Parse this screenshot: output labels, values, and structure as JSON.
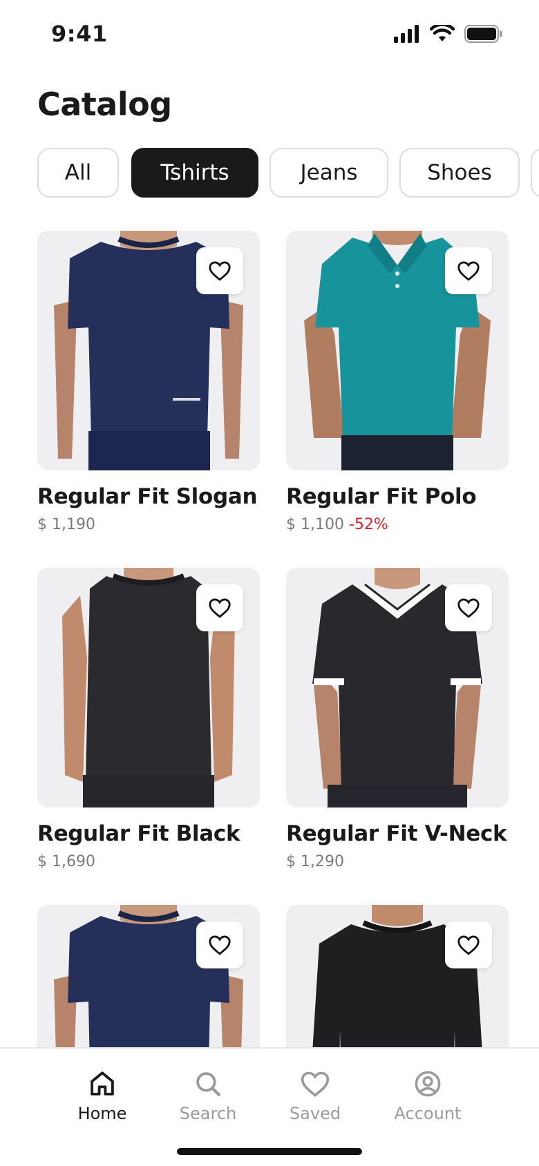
{
  "status": {
    "time": "9:41"
  },
  "header": {
    "title": "Catalog"
  },
  "filters": [
    {
      "label": "All",
      "active": false
    },
    {
      "label": "Tshirts",
      "active": true
    },
    {
      "label": "Jeans",
      "active": false
    },
    {
      "label": "Shoes",
      "active": false
    }
  ],
  "products": [
    {
      "name": "Regular Fit Slogan",
      "price": "$ 1,190",
      "discount": "",
      "color": "#24305a"
    },
    {
      "name": "Regular Fit Polo",
      "price": "$ 1,100",
      "discount": "-52%",
      "color": "#16939b"
    },
    {
      "name": "Regular Fit Black",
      "price": "$ 1,690",
      "discount": "",
      "color": "#2b2b2f"
    },
    {
      "name": "Regular Fit V-Neck",
      "price": "$ 1,290",
      "discount": "",
      "color": "#29282c"
    },
    {
      "name": "",
      "price": "",
      "discount": "",
      "color": "#24305a"
    },
    {
      "name": "",
      "price": "",
      "discount": "",
      "color": "#1f1f22"
    }
  ],
  "tabs": [
    {
      "label": "Home",
      "icon": "home-icon",
      "active": true
    },
    {
      "label": "Search",
      "icon": "search-icon",
      "active": false
    },
    {
      "label": "Saved",
      "icon": "heart-icon",
      "active": false
    },
    {
      "label": "Account",
      "icon": "account-icon",
      "active": false
    }
  ],
  "colors": {
    "accent": "#1a1a1a",
    "discount": "#e0202a",
    "muted": "#9a9a9a"
  }
}
